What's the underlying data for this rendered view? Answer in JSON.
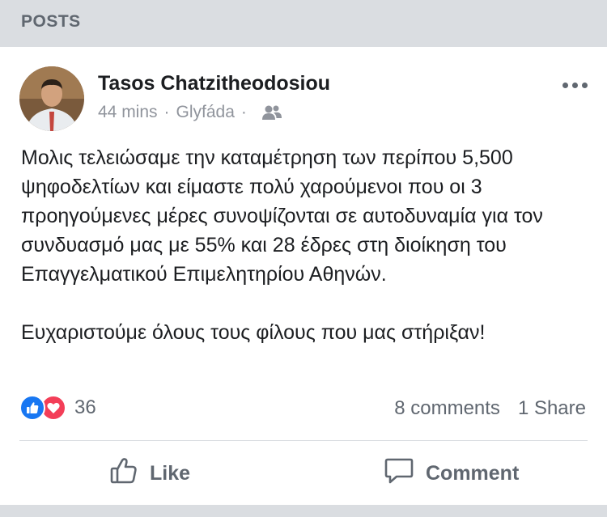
{
  "section": {
    "title": "POSTS"
  },
  "post": {
    "author": "Tasos Chatzitheodosiou",
    "time": "44 mins",
    "separator": "·",
    "location": "Glyfáda",
    "privacy_icon": "friends-icon",
    "paragraphs": [
      "Μολις τελειώσαμε την καταμέτρηση των περίπου 5,500 ψηφοδελτίων και είμαστε πολύ χαρούμενοι που οι 3 προηγούμενες μέρες συνοψίζονται σε αυτοδυναμία για τον συνδυασμό μας με 55% και 28 έδρες στη διοίκηση του Επαγγελματικού Επιμελητηρίου Αθηνών.",
      "Ευχαριστούμε όλους τους φίλους που μας στήριξαν!"
    ],
    "reactions": {
      "count": "36",
      "types": [
        "like",
        "love"
      ]
    },
    "comments_label": "8 comments",
    "shares_label": "1 Share"
  },
  "actions": {
    "like_label": "Like",
    "comment_label": "Comment"
  },
  "colors": {
    "header_bg": "#dadde1",
    "secondary_text": "#606770",
    "like_blue": "#1877f2",
    "love_red": "#f33e58"
  }
}
